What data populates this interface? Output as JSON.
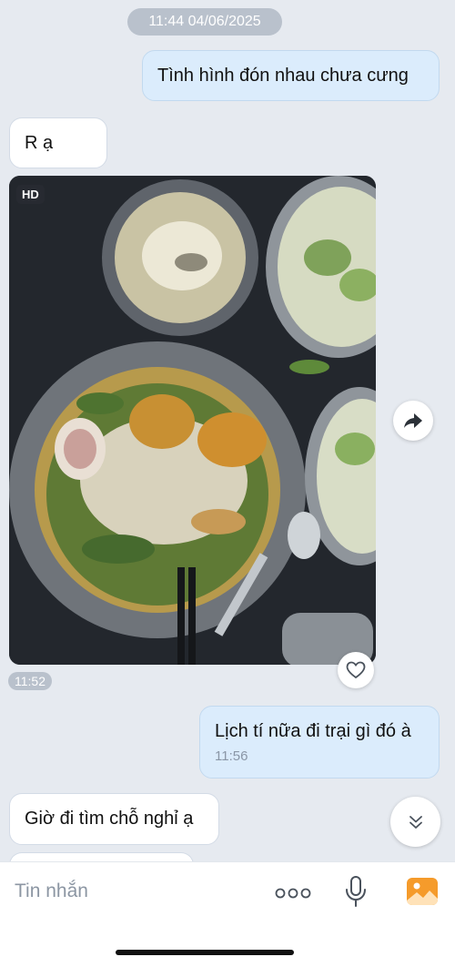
{
  "conversation": {
    "date_divider": "11:44 04/06/2025",
    "messages": [
      {
        "id": "m1",
        "direction": "out",
        "text": "Tình hình đón nhau chưa cưng"
      },
      {
        "id": "m2",
        "direction": "in",
        "text": "R ạ"
      },
      {
        "id": "m3",
        "direction": "in",
        "type": "photo",
        "badge": "HD",
        "time": "11:52"
      },
      {
        "id": "m4",
        "direction": "out",
        "text": "Lịch tí nữa đi trại gì đó à",
        "time": "11:56"
      },
      {
        "id": "m5",
        "direction": "in",
        "text": "Giờ đi tìm chỗ nghỉ ạ"
      }
    ]
  },
  "composer": {
    "placeholder": "Tin nhắn"
  },
  "icons": {
    "share": "share-arrow-icon",
    "heart": "heart-icon",
    "scroll_down": "double-chevron-down-icon",
    "more": "more-dots-icon",
    "mic": "microphone-icon",
    "gallery": "gallery-icon"
  },
  "colors": {
    "background": "#e6eaf0",
    "outgoing_bubble": "#dbecfc",
    "incoming_bubble": "#ffffff",
    "time_pill": "#b9c1cc",
    "gallery_orange": "#f59b2b"
  }
}
